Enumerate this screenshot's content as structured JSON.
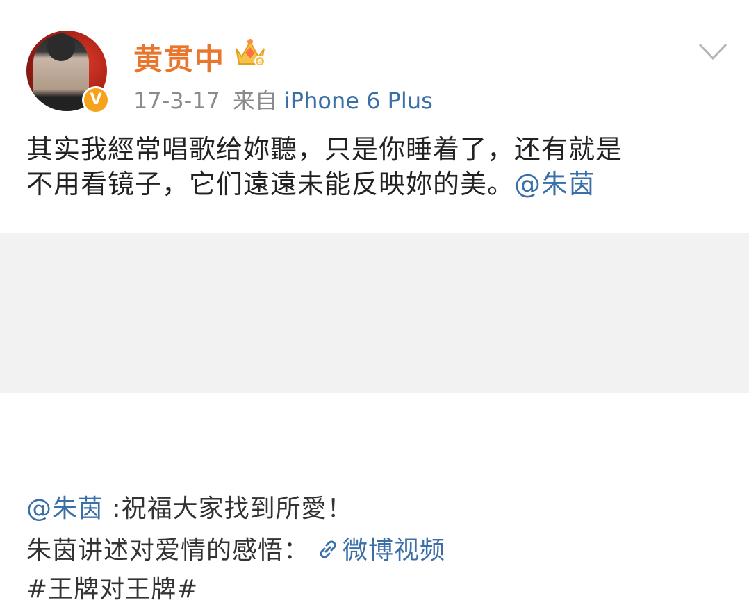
{
  "post": {
    "username": "黄贯中",
    "timestamp": "17-3-17",
    "source_label": "来自",
    "device": "iPhone 6 Plus",
    "verified_badge": "V",
    "text_line1": "其实我經常唱歌给妳聽，只是你睡着了，还有就是",
    "text_line2": "不用看镜子，它们遠遠未能反映妳的美。",
    "mention": "@朱茵"
  },
  "repost": {
    "mention": "@朱茵",
    "text1": " :祝福大家找到所愛！",
    "text2": "朱茵讲述对爱情的感悟：",
    "video_link": "微博视频",
    "hashtag": "#王牌对王牌#"
  },
  "colors": {
    "username": "#e8762d",
    "link": "#3a6fa8",
    "meta": "#8a8a8a",
    "repost_bg": "#f2f2f2",
    "verified": "#f7a21b"
  },
  "icons": [
    "avatar",
    "verified-icon",
    "crown-icon",
    "chevron-down-icon",
    "link-icon"
  ]
}
